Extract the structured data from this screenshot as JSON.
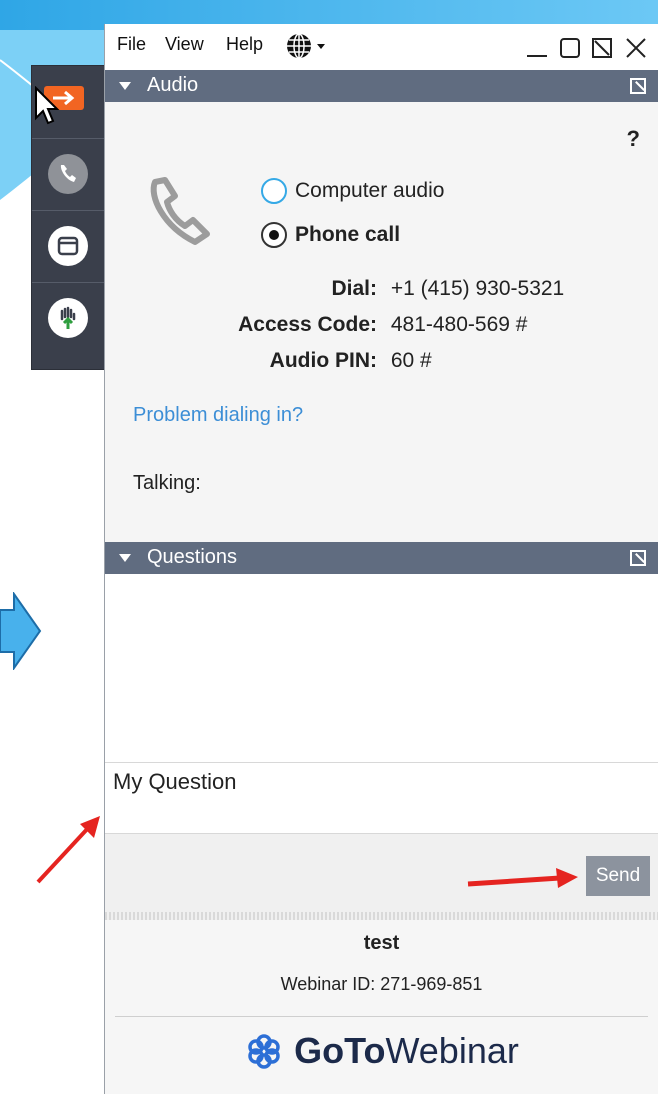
{
  "menu": {
    "file": "File",
    "view": "View",
    "help": "Help"
  },
  "audio": {
    "header": "Audio",
    "help_mark": "?",
    "options": [
      {
        "label": "Computer audio",
        "selected": false
      },
      {
        "label": "Phone call",
        "selected": true
      }
    ],
    "dial_label": "Dial:",
    "dial_value": "+1 (415) 930-5321",
    "access_label": "Access Code:",
    "access_value": "481-480-569 #",
    "pin_label": "Audio PIN:",
    "pin_value": "60 #",
    "problem_link": "Problem dialing in?",
    "talking": "Talking:"
  },
  "questions": {
    "header": "Questions",
    "input_value": "My Question",
    "send_label": "Send"
  },
  "footer": {
    "title": "test",
    "webinar_id": "Webinar ID: 271-969-851",
    "brand_goto": "GoTo",
    "brand_webinar": "Webinar"
  },
  "colors": {
    "header_bg": "#606c80",
    "link": "#3c8ed6",
    "toolbar_accent": "#f26522",
    "annotation": "#e52420"
  }
}
